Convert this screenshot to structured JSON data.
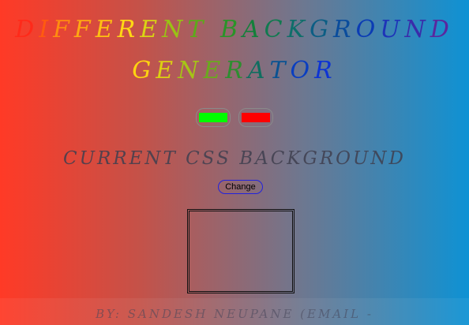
{
  "header": {
    "title_line1": "DIFFERENT BACKGROUND",
    "title_line2": "GENERATOR"
  },
  "title_colors": {
    "line1": [
      "#ff2a1a",
      "#ff5a10",
      "#ff8c10",
      "#ffa812",
      "#ffc012",
      "#ffd814",
      "#d9d414",
      "#99c214",
      "#5caa1a",
      "#2a9428",
      "#13803a",
      "#117a50",
      "#0e6e6a",
      "#0c5e84",
      "#0a4c9c",
      "#0b3cb4",
      "#1e34b8",
      "#3a2caa",
      "#5a269e",
      "#7e2a9e"
    ],
    "line2": [
      "#ffd410",
      "#dcd012",
      "#a6c416",
      "#6aaa1e",
      "#2e8e30",
      "#106e60",
      "#0a5292",
      "#0a3ec0",
      "#0e34d4"
    ]
  },
  "swatches": [
    {
      "name": "green",
      "color": "#00ff00"
    },
    {
      "name": "red",
      "color": "#ff0000"
    }
  ],
  "main": {
    "subheading": "CURRENT CSS BACKGROUND",
    "change_button": "Change"
  },
  "footer": {
    "text": "BY: SANDESH NEUPANE (EMAIL -"
  }
}
